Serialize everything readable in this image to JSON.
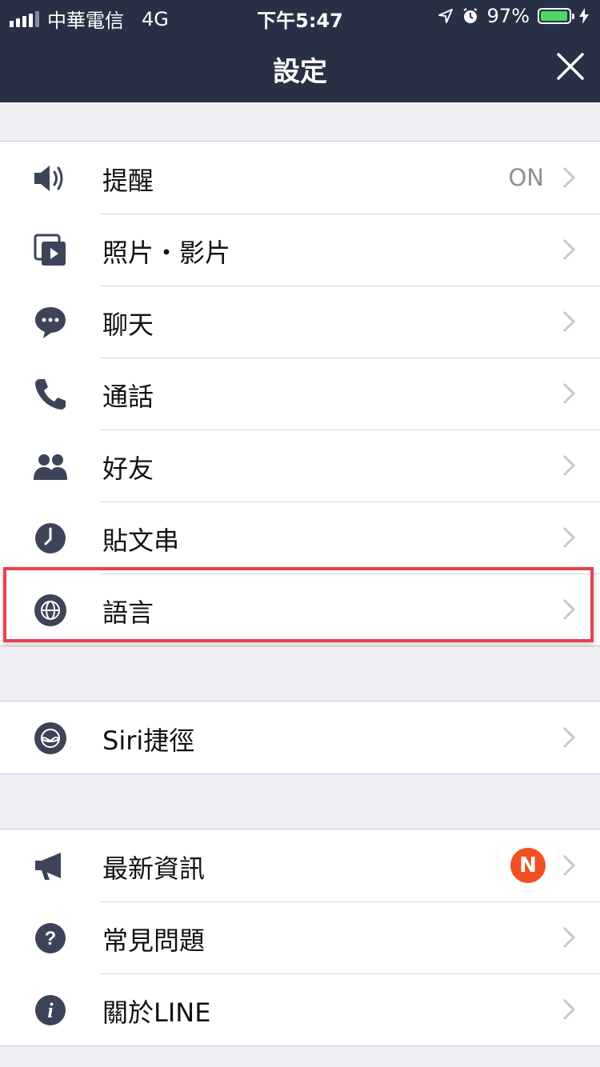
{
  "status_bar": {
    "carrier": "中華電信",
    "network": "4G",
    "time": "下午5:47",
    "battery": "97%",
    "battery_level": 0.97,
    "battery_color": "#4cd964"
  },
  "nav": {
    "title": "設定",
    "close_icon": "close-icon",
    "bg_color": "#283045"
  },
  "groups": [
    {
      "items": [
        {
          "label": "提醒",
          "value": "ON",
          "icon": "speaker-icon"
        },
        {
          "label": "照片・影片",
          "icon": "media-icon"
        },
        {
          "label": "聊天",
          "icon": "chat-bubble-icon"
        },
        {
          "label": "通話",
          "icon": "phone-icon"
        },
        {
          "label": "好友",
          "icon": "friends-icon"
        },
        {
          "label": "貼文串",
          "icon": "clock-icon"
        },
        {
          "label": "語言",
          "icon": "globe-icon",
          "highlighted": true
        }
      ]
    },
    {
      "items": [
        {
          "label": "Siri捷徑",
          "icon": "siri-icon"
        }
      ]
    },
    {
      "items": [
        {
          "label": "最新資訊",
          "badge": "N",
          "icon": "megaphone-icon"
        },
        {
          "label": "常見問題",
          "icon": "question-icon"
        },
        {
          "label": "關於LINE",
          "icon": "info-icon"
        }
      ]
    }
  ],
  "colors": {
    "icon": "#3d4459",
    "badge": "#f05025",
    "highlight": "#e8424c"
  }
}
